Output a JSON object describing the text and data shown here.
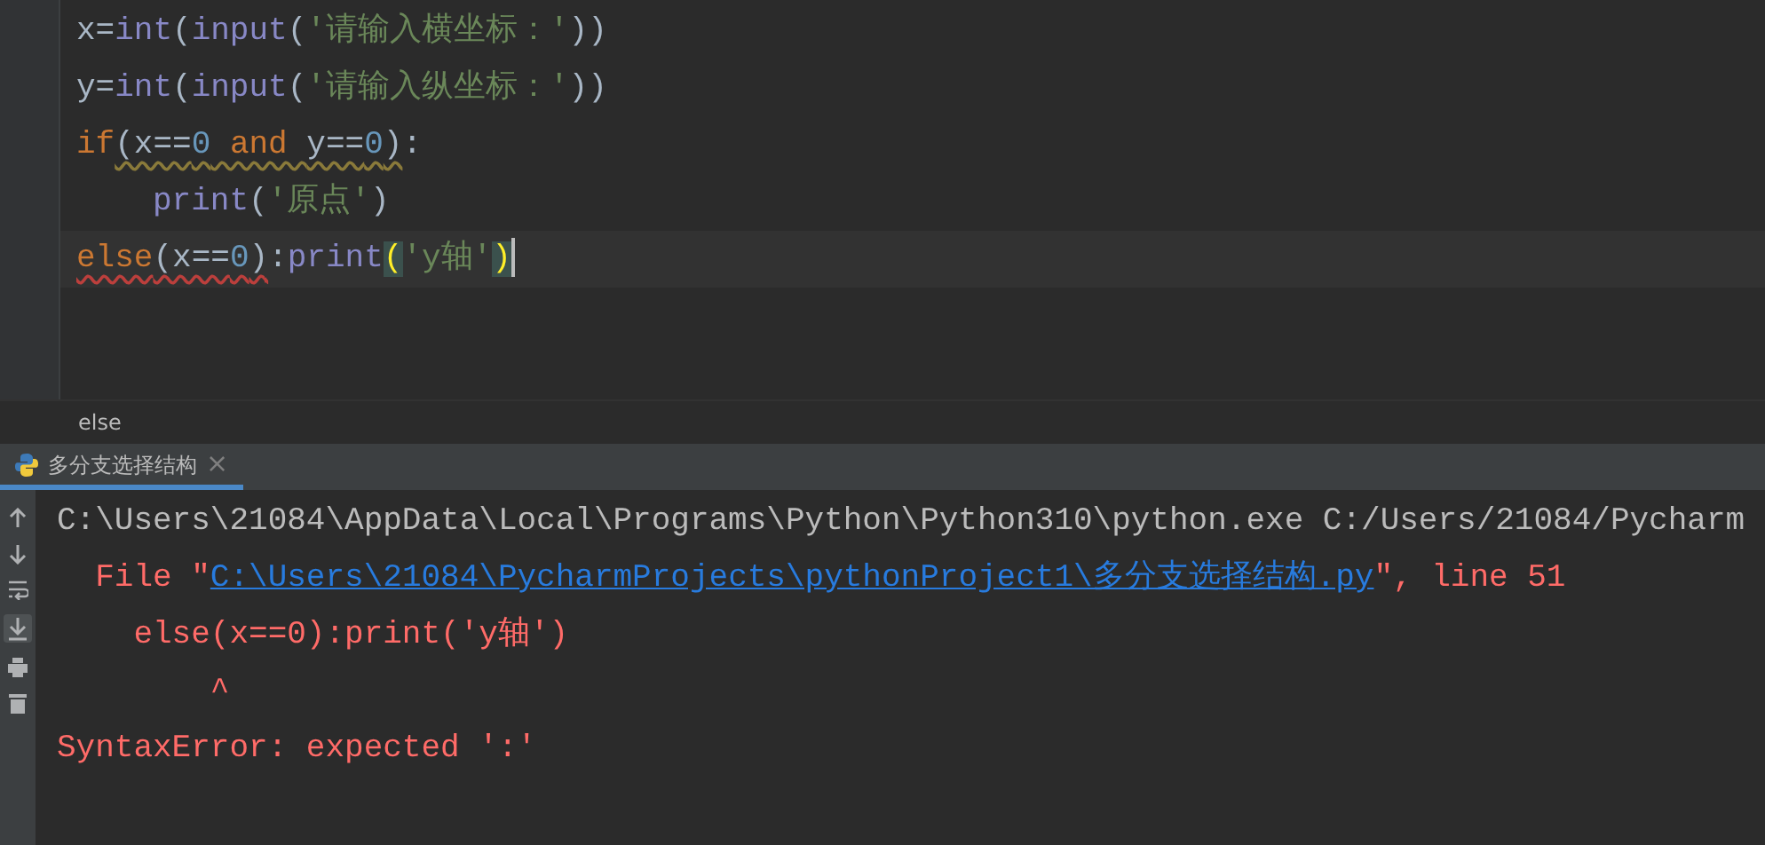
{
  "editor": {
    "lines": [
      {
        "current": false,
        "indented": false,
        "tokens": [
          {
            "text": "x=",
            "kind": "plain"
          },
          {
            "text": "int",
            "kind": "func"
          },
          {
            "text": "(",
            "kind": "plain"
          },
          {
            "text": "input",
            "kind": "func"
          },
          {
            "text": "(",
            "kind": "plain"
          },
          {
            "text": "'请输入横坐标：'",
            "kind": "str"
          },
          {
            "text": "))",
            "kind": "plain"
          }
        ]
      },
      {
        "current": false,
        "indented": false,
        "tokens": [
          {
            "text": "y=",
            "kind": "plain"
          },
          {
            "text": "int",
            "kind": "func"
          },
          {
            "text": "(",
            "kind": "plain"
          },
          {
            "text": "input",
            "kind": "func"
          },
          {
            "text": "(",
            "kind": "plain"
          },
          {
            "text": "'请输入纵坐标：'",
            "kind": "str"
          },
          {
            "text": "))",
            "kind": "plain"
          }
        ]
      },
      {
        "current": false,
        "indented": false,
        "tokens": [
          {
            "text": "if",
            "kind": "kw"
          },
          {
            "text": "(x==",
            "kind": "plain",
            "warning": true
          },
          {
            "text": "0",
            "kind": "num",
            "warning": true
          },
          {
            "text": " and ",
            "kind": "kw",
            "warning": true
          },
          {
            "text": "y==",
            "kind": "plain",
            "warning": true
          },
          {
            "text": "0",
            "kind": "num",
            "warning": true
          },
          {
            "text": ")",
            "kind": "plain",
            "warning": true
          },
          {
            "text": ":",
            "kind": "plain"
          }
        ]
      },
      {
        "current": false,
        "indented": true,
        "tokens": [
          {
            "text": "print",
            "kind": "func"
          },
          {
            "text": "(",
            "kind": "plain"
          },
          {
            "text": "'原点'",
            "kind": "str"
          },
          {
            "text": ")",
            "kind": "plain"
          }
        ]
      },
      {
        "current": true,
        "indented": false,
        "tokens": [
          {
            "text": "else",
            "kind": "kw",
            "error": true
          },
          {
            "text": "(x==",
            "kind": "plain",
            "error": true
          },
          {
            "text": "0",
            "kind": "num",
            "error": true
          },
          {
            "text": ")",
            "kind": "plain",
            "error": true
          },
          {
            "text": ":",
            "kind": "plain"
          },
          {
            "text": "print",
            "kind": "func"
          },
          {
            "text": "(",
            "kind": "plain",
            "matched": true
          },
          {
            "text": "'y轴'",
            "kind": "str"
          },
          {
            "text": ")",
            "kind": "plain",
            "matched": true
          }
        ]
      }
    ]
  },
  "breadcrumb": "else",
  "run_tab": {
    "title": "多分支选择结构",
    "close": "×",
    "selected": true
  },
  "console": {
    "lines": [
      [
        {
          "text": "C:\\Users\\21084\\AppData\\Local\\Programs\\Python\\Python310\\python.exe C:/Users/21084/Pycharm",
          "kind": "plain"
        }
      ],
      [
        {
          "text": "  File \"",
          "kind": "error"
        },
        {
          "text": "C:\\Users\\21084\\PycharmProjects\\pythonProject1\\多分支选择结构.py",
          "kind": "link"
        },
        {
          "text": "\", line 51",
          "kind": "error"
        }
      ],
      [
        {
          "text": "    else(x==0):print('y轴')",
          "kind": "error"
        }
      ],
      [
        {
          "text": "        ^",
          "kind": "error"
        }
      ],
      [
        {
          "text": "SyntaxError: expected ':'",
          "kind": "error"
        }
      ]
    ]
  }
}
